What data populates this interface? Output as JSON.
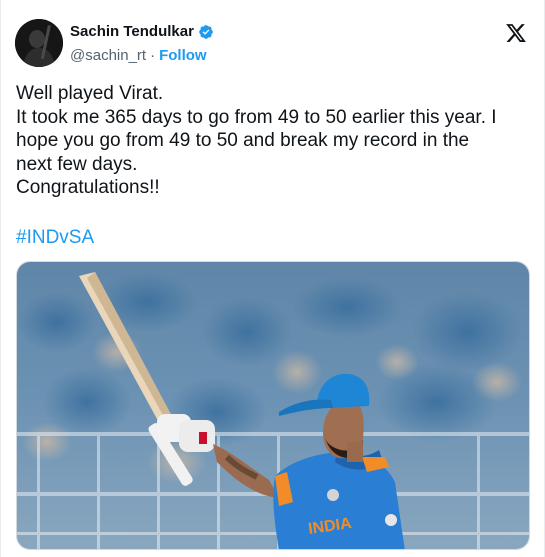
{
  "author": {
    "name": "Sachin Tendulkar",
    "handle": "@sachin_rt",
    "separator": "·",
    "follow_label": "Follow",
    "verified": true
  },
  "tweet": {
    "lines": [
      "Well played Virat.",
      "It took me 365 days to go from 49 to 50 earlier this year. I",
      "hope you go from 49 to 50 and break my record in the",
      "next few days.",
      "Congratulations!!"
    ],
    "hashtag": "#INDvSA"
  },
  "media": {
    "description_icon": "photo",
    "jersey_text": "INDIA"
  },
  "colors": {
    "accent": "#1d9bf0",
    "text": "#0f1419",
    "muted": "#536471",
    "jersey": "#2a7fd4",
    "helmet": "#1f86d6"
  },
  "icons": {
    "brand": "x-logo-icon",
    "verified": "verified-badge-icon"
  }
}
